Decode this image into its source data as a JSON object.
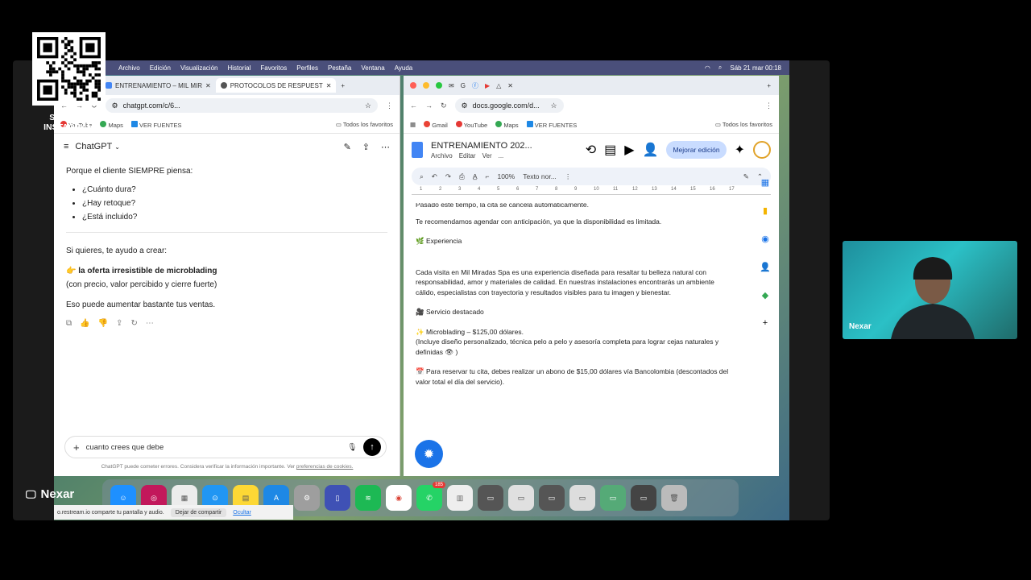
{
  "overlay": {
    "follow_text": "SÍGUEME INSTAGRAM",
    "camera_name": "Nexar",
    "presenter_name": "Nexar"
  },
  "menubar": {
    "items": [
      "Archivo",
      "Edición",
      "Visualización",
      "Historial",
      "Favoritos",
      "Perfiles",
      "Pestaña",
      "Ventana",
      "Ayuda"
    ],
    "clock": "Sáb 21 mar  00:18"
  },
  "left_browser": {
    "tabs": [
      "ENTRENAMIENTO – MIL MIR",
      "PROTOCOLOS DE RESPUEST"
    ],
    "url": "chatgpt.com/c/6...",
    "bookmarks": [
      "YouTube",
      "Maps",
      "VER FUENTES"
    ],
    "all_bookmarks": "Todos los favoritos"
  },
  "chatgpt": {
    "title": "ChatGPT",
    "intro": "Porque el cliente SIEMPRE piensa:",
    "bullets": [
      "¿Cuánto dura?",
      "¿Hay retoque?",
      "¿Está incluido?"
    ],
    "offer_intro": "Si quieres, te ayudo a crear:",
    "offer_title": "la oferta irresistible de microblading",
    "offer_sub": "(con precio, valor percibido y cierre fuerte)",
    "closing": "Eso puede aumentar bastante tus ventas.",
    "input_value": "cuanto crees que debe",
    "disclaimer": "ChatGPT puede cometer errores. Considera verificar la información importante. Ver",
    "disclaimer_link": "preferencias de cookies."
  },
  "right_browser": {
    "url": "docs.google.com/d...",
    "bookmarks": [
      "Gmail",
      "YouTube",
      "Maps",
      "VER FUENTES"
    ],
    "all_bookmarks": "Todos los favoritos"
  },
  "doc": {
    "title": "ENTRENAMIENTO 202...",
    "menus": [
      "Archivo",
      "Editar",
      "Ver",
      "..."
    ],
    "mejorar": "Mejorar edición",
    "zoom": "100%",
    "style": "Texto nor...",
    "ruler": [
      "1",
      "2",
      "3",
      "4",
      "5",
      "6",
      "7",
      "8",
      "9",
      "10",
      "11",
      "12",
      "13",
      "14",
      "15",
      "16",
      "17"
    ],
    "cut_line": "Pasado este tiempo, la cita se cancela automáticamente.",
    "agenda": "Te recomendamos agendar con anticipación, ya que la disponibilidad es limitada.",
    "exp_title": "Experiencia",
    "exp_body": "Cada visita en Mil Miradas Spa es una experiencia diseñada para resaltar tu belleza natural con responsabilidad, amor y materiales de calidad. En nuestras instalaciones encontrarás un ambiente cálido, especialistas con trayectoria y resultados visibles para tu imagen y bienestar.",
    "serv_title": "Servicio destacado",
    "serv_line": "Microblading – $125,00 dólares.",
    "serv_detail": "(Incluye diseño personalizado, técnica pelo a pelo y asesoría completa para lograr cejas naturales y definidas 👁 )",
    "reserva": "Para reservar tu cita, debes realizar un abono de $15,00 dólares  vía Bancolombia (descontados del valor total el día del servicio)."
  },
  "sharebar": {
    "text": "o.restream.io comparte tu pantalla y audio.",
    "stop": "Dejar de compartir",
    "hide": "Ocultar"
  },
  "dock": {
    "badge": "185"
  }
}
